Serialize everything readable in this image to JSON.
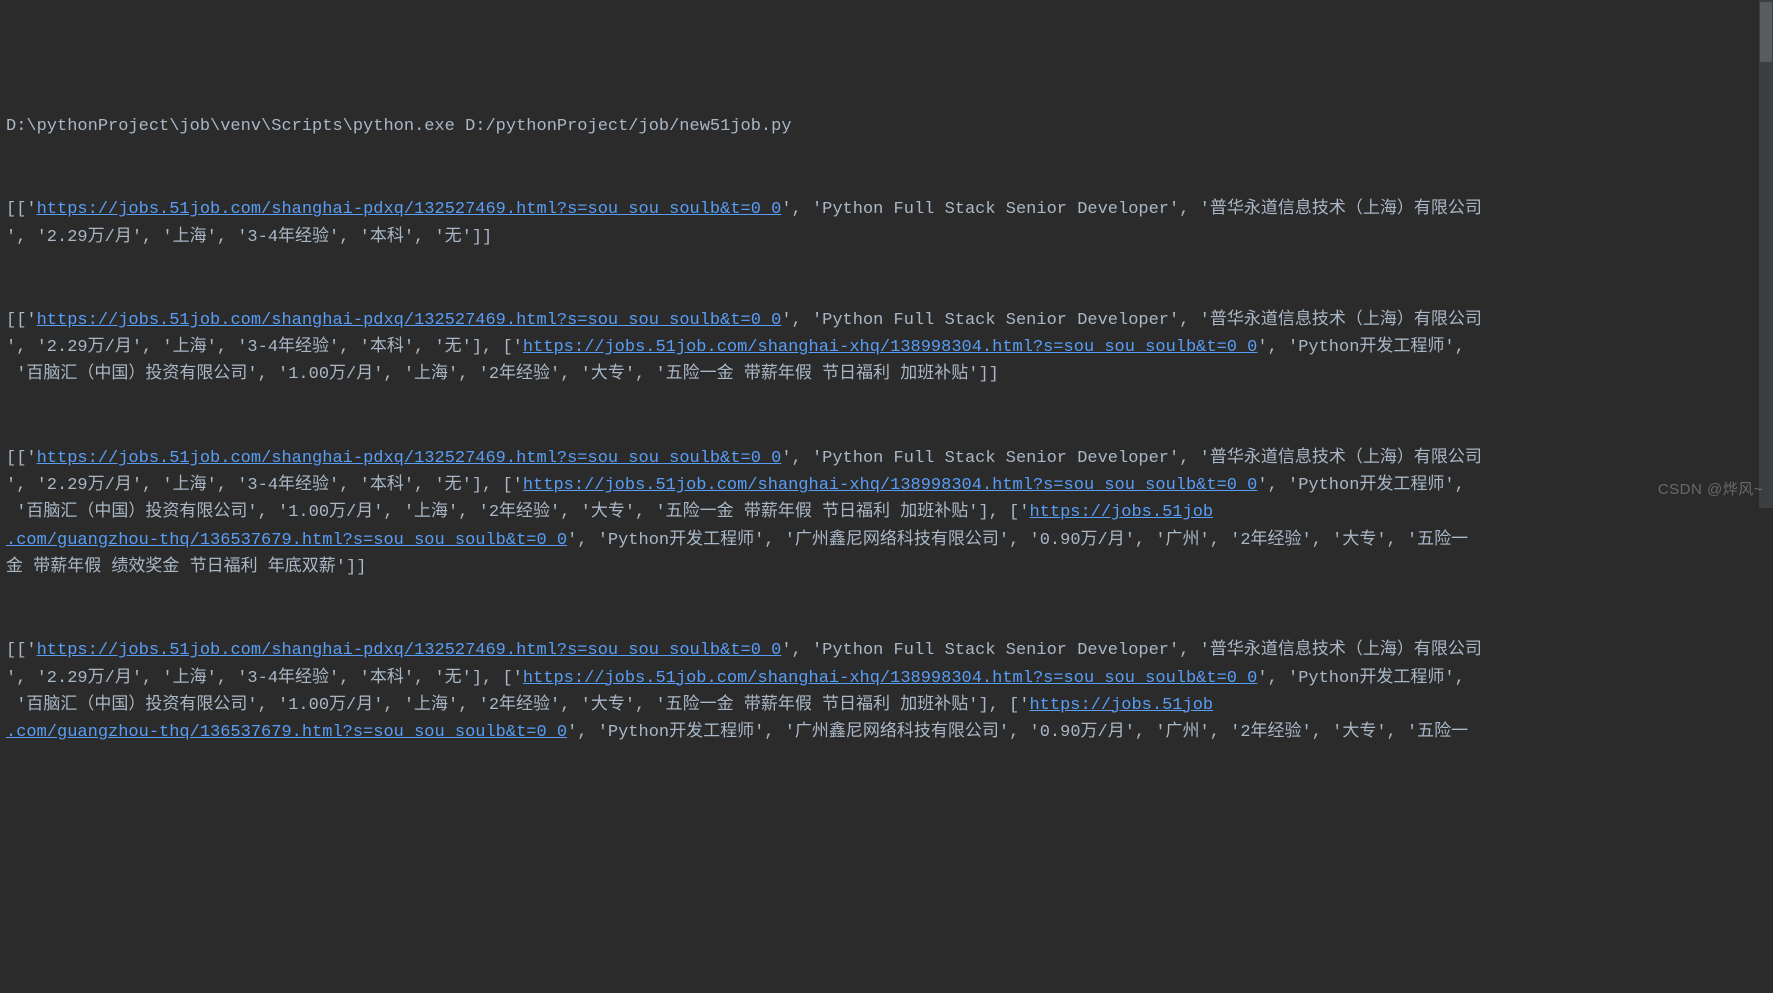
{
  "cmd": "D:\\pythonProject\\job\\venv\\Scripts\\python.exe D:/pythonProject/job/new51job.py",
  "urls": {
    "u1": "https://jobs.51job.com/shanghai-pdxq/132527469.html?s=sou_sou_soulb&t=0_0",
    "u2": "https://jobs.51job.com/shanghai-xhq/138998304.html?s=sou_sou_soulb&t=0_0",
    "u3a": "https://jobs.51job",
    "u3b": ".com/guangzhou-thq/136537679.html?s=sou_sou_soulb&t=0_0"
  },
  "t": {
    "job1_title": "', 'Python Full Stack Senior Developer', '普华永道信息技术（上海）有限公司",
    "job1_rest_end": "', '2.29万/月', '上海', '3-4年经验', '本科', '无']]",
    "job1_rest_mid": "', '2.29万/月', '上海', '3-4年经验', '本科', '无'], ['",
    "job2_title": "', 'Python开发工程师',",
    "job2_rest_end": " '百脑汇（中国）投资有限公司', '1.00万/月', '上海', '2年经验', '大专', '五险一金 带薪年假 节日福利 加班补贴']]",
    "job2_rest_mid": " '百脑汇（中国）投资有限公司', '1.00万/月', '上海', '2年经验', '大专', '五险一金 带薪年假 节日福利 加班补贴'], ['",
    "job3_title": "', 'Python开发工程师', '广州鑫尼网络科技有限公司', '0.90万/月', '广州', '2年经验', '大专', '五险一",
    "job3_rest_end": "金 带薪年假 绩效奖金 节日福利 年底双薪']]",
    "job3_title_b": "', 'Python开发工程师', '广州鑫尼网络科技有限公司', '0.90万/月', '广州', '2年经验', '大专', '五险一",
    "open": "[['",
    "close_q": "'"
  },
  "watermark": "CSDN @烨风~"
}
